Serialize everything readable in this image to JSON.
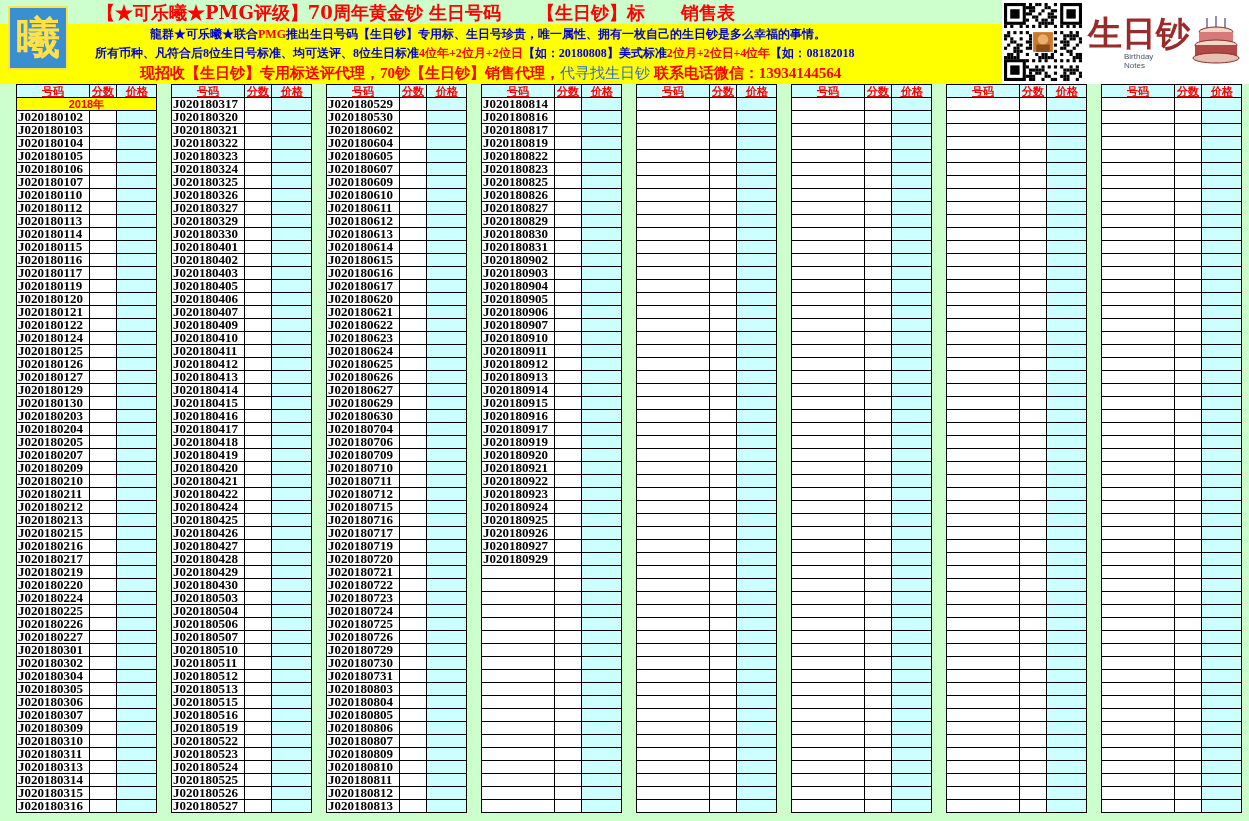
{
  "banner": {
    "logo_glyph": "曦",
    "title": "【★可乐曦★PMG评级】70周年黄金钞 生日号码　　【生日钞】标　　销售表",
    "lines": [
      [
        {
          "text": "龍群★可乐曦★联合",
          "color": "#0000cc"
        },
        {
          "text": "PMG",
          "color": "#ff0000"
        },
        {
          "text": "推出生日号码【生日钞】专用标、生日号珍贵，唯一属性、拥有一枚自己的生日钞是多么幸福的事情。",
          "color": "#0000cc"
        }
      ],
      [
        {
          "text": "所有币种、凡符合后8位生日号标准、均可送评、8位生日标准",
          "color": "#0000cc"
        },
        {
          "text": "4位年+2位月+2位日",
          "color": "#ff0000"
        },
        {
          "text": "【如：20180808】美式标准",
          "color": "#0000cc"
        },
        {
          "text": "2位月+2位日+4位年",
          "color": "#ff0000"
        },
        {
          "text": "【如：08182018",
          "color": "#0000cc"
        }
      ],
      [
        {
          "text": "现招收【生日钞】专用标送评代理，70钞【生日钞】销售代理，",
          "color": "#ff0000"
        },
        {
          "text": "代寻找生日钞",
          "color": "#3366cc"
        },
        {
          "text": " 联系电话微信：13934144564",
          "color": "#ff0000"
        }
      ]
    ],
    "brand": {
      "text": "生日钞",
      "subtitle_1": "Birthday",
      "subtitle_2": "Notes"
    }
  },
  "table": {
    "column_groups": [
      {
        "headers": [
          "号码",
          "分数",
          "价格"
        ],
        "rows": [
          {
            "kind": "year",
            "text": "2018年"
          },
          {
            "kind": "code",
            "code": "J020180102"
          },
          {
            "kind": "code",
            "code": "J020180103"
          },
          {
            "kind": "code",
            "code": "J020180104"
          },
          {
            "kind": "code",
            "code": "J020180105"
          },
          {
            "kind": "code",
            "code": "J020180106"
          },
          {
            "kind": "code",
            "code": "J020180107"
          },
          {
            "kind": "code",
            "code": "J020180110"
          },
          {
            "kind": "code",
            "code": "J020180112"
          },
          {
            "kind": "code",
            "code": "J020180113"
          },
          {
            "kind": "code",
            "code": "J020180114"
          },
          {
            "kind": "code",
            "code": "J020180115"
          },
          {
            "kind": "code",
            "code": "J020180116"
          },
          {
            "kind": "code",
            "code": "J020180117"
          },
          {
            "kind": "code",
            "code": "J020180119"
          },
          {
            "kind": "code",
            "code": "J020180120"
          },
          {
            "kind": "code",
            "code": "J020180121"
          },
          {
            "kind": "code",
            "code": "J020180122"
          },
          {
            "kind": "code",
            "code": "J020180124"
          },
          {
            "kind": "code",
            "code": "J020180125"
          },
          {
            "kind": "code",
            "code": "J020180126"
          },
          {
            "kind": "code",
            "code": "J020180127"
          },
          {
            "kind": "code",
            "code": "J020180129"
          },
          {
            "kind": "code",
            "code": "J020180130"
          },
          {
            "kind": "code",
            "code": "J020180203"
          },
          {
            "kind": "code",
            "code": "J020180204"
          },
          {
            "kind": "code",
            "code": "J020180205"
          },
          {
            "kind": "code",
            "code": "J020180207"
          },
          {
            "kind": "code",
            "code": "J020180209"
          },
          {
            "kind": "code",
            "code": "J020180210"
          },
          {
            "kind": "code",
            "code": "J020180211"
          },
          {
            "kind": "code",
            "code": "J020180212"
          },
          {
            "kind": "code",
            "code": "J020180213"
          },
          {
            "kind": "code",
            "code": "J020180215"
          },
          {
            "kind": "code",
            "code": "J020180216"
          },
          {
            "kind": "code",
            "code": "J020180217"
          },
          {
            "kind": "code",
            "code": "J020180219"
          },
          {
            "kind": "code",
            "code": "J020180220"
          },
          {
            "kind": "code",
            "code": "J020180224"
          },
          {
            "kind": "code",
            "code": "J020180225"
          },
          {
            "kind": "code",
            "code": "J020180226"
          },
          {
            "kind": "code",
            "code": "J020180227"
          },
          {
            "kind": "code",
            "code": "J020180301"
          },
          {
            "kind": "code",
            "code": "J020180302"
          },
          {
            "kind": "code",
            "code": "J020180304"
          },
          {
            "kind": "code",
            "code": "J020180305"
          },
          {
            "kind": "code",
            "code": "J020180306"
          },
          {
            "kind": "code",
            "code": "J020180307"
          },
          {
            "kind": "code",
            "code": "J020180309"
          },
          {
            "kind": "code",
            "code": "J020180310"
          },
          {
            "kind": "code",
            "code": "J020180311"
          },
          {
            "kind": "code",
            "code": "J020180313"
          },
          {
            "kind": "code",
            "code": "J020180314"
          },
          {
            "kind": "code",
            "code": "J020180315"
          },
          {
            "kind": "code",
            "code": "J020180316"
          }
        ]
      },
      {
        "headers": [
          "号码",
          "分数",
          "价格"
        ],
        "rows": [
          {
            "kind": "code",
            "code": "J020180317"
          },
          {
            "kind": "code",
            "code": "J020180320"
          },
          {
            "kind": "code",
            "code": "J020180321"
          },
          {
            "kind": "code",
            "code": "J020180322"
          },
          {
            "kind": "code",
            "code": "J020180323"
          },
          {
            "kind": "code",
            "code": "J020180324"
          },
          {
            "kind": "code",
            "code": "J020180325"
          },
          {
            "kind": "code",
            "code": "J020180326"
          },
          {
            "kind": "code",
            "code": "J020180327"
          },
          {
            "kind": "code",
            "code": "J020180329"
          },
          {
            "kind": "code",
            "code": "J020180330"
          },
          {
            "kind": "code",
            "code": "J020180401"
          },
          {
            "kind": "code",
            "code": "J020180402"
          },
          {
            "kind": "code",
            "code": "J020180403"
          },
          {
            "kind": "code",
            "code": "J020180405"
          },
          {
            "kind": "code",
            "code": "J020180406"
          },
          {
            "kind": "code",
            "code": "J020180407"
          },
          {
            "kind": "code",
            "code": "J020180409"
          },
          {
            "kind": "code",
            "code": "J020180410"
          },
          {
            "kind": "code",
            "code": "J020180411"
          },
          {
            "kind": "code",
            "code": "J020180412"
          },
          {
            "kind": "code",
            "code": "J020180413"
          },
          {
            "kind": "code",
            "code": "J020180414"
          },
          {
            "kind": "code",
            "code": "J020180415"
          },
          {
            "kind": "code",
            "code": "J020180416"
          },
          {
            "kind": "code",
            "code": "J020180417"
          },
          {
            "kind": "code",
            "code": "J020180418"
          },
          {
            "kind": "code",
            "code": "J020180419"
          },
          {
            "kind": "code",
            "code": "J020180420"
          },
          {
            "kind": "code",
            "code": "J020180421"
          },
          {
            "kind": "code",
            "code": "J020180422"
          },
          {
            "kind": "code",
            "code": "J020180424"
          },
          {
            "kind": "code",
            "code": "J020180425"
          },
          {
            "kind": "code",
            "code": "J020180426"
          },
          {
            "kind": "code",
            "code": "J020180427"
          },
          {
            "kind": "code",
            "code": "J020180428"
          },
          {
            "kind": "code",
            "code": "J020180429"
          },
          {
            "kind": "code",
            "code": "J020180430"
          },
          {
            "kind": "code",
            "code": "J020180503"
          },
          {
            "kind": "code",
            "code": "J020180504"
          },
          {
            "kind": "code",
            "code": "J020180506"
          },
          {
            "kind": "code",
            "code": "J020180507"
          },
          {
            "kind": "code",
            "code": "J020180510"
          },
          {
            "kind": "code",
            "code": "J020180511"
          },
          {
            "kind": "code",
            "code": "J020180512"
          },
          {
            "kind": "code",
            "code": "J020180513"
          },
          {
            "kind": "code",
            "code": "J020180515"
          },
          {
            "kind": "code",
            "code": "J020180516"
          },
          {
            "kind": "code",
            "code": "J020180519"
          },
          {
            "kind": "code",
            "code": "J020180522"
          },
          {
            "kind": "code",
            "code": "J020180523"
          },
          {
            "kind": "code",
            "code": "J020180524"
          },
          {
            "kind": "code",
            "code": "J020180525"
          },
          {
            "kind": "code",
            "code": "J020180526"
          },
          {
            "kind": "code",
            "code": "J020180527"
          }
        ]
      },
      {
        "headers": [
          "号码",
          "分数",
          "价格"
        ],
        "rows": [
          {
            "kind": "code",
            "code": "J020180529"
          },
          {
            "kind": "code",
            "code": "J020180530"
          },
          {
            "kind": "code",
            "code": "J020180602"
          },
          {
            "kind": "code",
            "code": "J020180604"
          },
          {
            "kind": "code",
            "code": "J020180605"
          },
          {
            "kind": "code",
            "code": "J020180607"
          },
          {
            "kind": "code",
            "code": "J020180609"
          },
          {
            "kind": "code",
            "code": "J020180610"
          },
          {
            "kind": "code",
            "code": "J020180611"
          },
          {
            "kind": "code",
            "code": "J020180612"
          },
          {
            "kind": "code",
            "code": "J020180613"
          },
          {
            "kind": "code",
            "code": "J020180614"
          },
          {
            "kind": "code",
            "code": "J020180615"
          },
          {
            "kind": "code",
            "code": "J020180616"
          },
          {
            "kind": "code",
            "code": "J020180617"
          },
          {
            "kind": "code",
            "code": "J020180620"
          },
          {
            "kind": "code",
            "code": "J020180621"
          },
          {
            "kind": "code",
            "code": "J020180622"
          },
          {
            "kind": "code",
            "code": "J020180623"
          },
          {
            "kind": "code",
            "code": "J020180624"
          },
          {
            "kind": "code",
            "code": "J020180625"
          },
          {
            "kind": "code",
            "code": "J020180626"
          },
          {
            "kind": "code",
            "code": "J020180627"
          },
          {
            "kind": "code",
            "code": "J020180629"
          },
          {
            "kind": "code",
            "code": "J020180630"
          },
          {
            "kind": "code",
            "code": "J020180704"
          },
          {
            "kind": "code",
            "code": "J020180706"
          },
          {
            "kind": "code",
            "code": "J020180709"
          },
          {
            "kind": "code",
            "code": "J020180710"
          },
          {
            "kind": "code",
            "code": "J020180711"
          },
          {
            "kind": "code",
            "code": "J020180712"
          },
          {
            "kind": "code",
            "code": "J020180715"
          },
          {
            "kind": "code",
            "code": "J020180716"
          },
          {
            "kind": "code",
            "code": "J020180717"
          },
          {
            "kind": "code",
            "code": "J020180719"
          },
          {
            "kind": "code",
            "code": "J020180720"
          },
          {
            "kind": "code",
            "code": "J020180721"
          },
          {
            "kind": "code",
            "code": "J020180722"
          },
          {
            "kind": "code",
            "code": "J020180723"
          },
          {
            "kind": "code",
            "code": "J020180724"
          },
          {
            "kind": "code",
            "code": "J020180725"
          },
          {
            "kind": "code",
            "code": "J020180726"
          },
          {
            "kind": "code",
            "code": "J020180729"
          },
          {
            "kind": "code",
            "code": "J020180730"
          },
          {
            "kind": "code",
            "code": "J020180731"
          },
          {
            "kind": "code",
            "code": "J020180803"
          },
          {
            "kind": "code",
            "code": "J020180804"
          },
          {
            "kind": "code",
            "code": "J020180805"
          },
          {
            "kind": "code",
            "code": "J020180806"
          },
          {
            "kind": "code",
            "code": "J020180807"
          },
          {
            "kind": "code",
            "code": "J020180809"
          },
          {
            "kind": "code",
            "code": "J020180810"
          },
          {
            "kind": "code",
            "code": "J020180811"
          },
          {
            "kind": "code",
            "code": "J020180812"
          },
          {
            "kind": "code",
            "code": "J020180813"
          }
        ]
      },
      {
        "headers": [
          "号码",
          "分数",
          "价格"
        ],
        "rows": [
          {
            "kind": "code",
            "code": "J020180814"
          },
          {
            "kind": "code",
            "code": "J020180816"
          },
          {
            "kind": "code",
            "code": "J020180817"
          },
          {
            "kind": "code",
            "code": "J020180819"
          },
          {
            "kind": "code",
            "code": "J020180822"
          },
          {
            "kind": "code",
            "code": "J020180823"
          },
          {
            "kind": "code",
            "code": "J020180825"
          },
          {
            "kind": "code",
            "code": "J020180826"
          },
          {
            "kind": "code",
            "code": "J020180827"
          },
          {
            "kind": "code",
            "code": "J020180829"
          },
          {
            "kind": "code",
            "code": "J020180830"
          },
          {
            "kind": "code",
            "code": "J020180831"
          },
          {
            "kind": "code",
            "code": "J020180902"
          },
          {
            "kind": "code",
            "code": "J020180903"
          },
          {
            "kind": "code",
            "code": "J020180904"
          },
          {
            "kind": "code",
            "code": "J020180905"
          },
          {
            "kind": "code",
            "code": "J020180906"
          },
          {
            "kind": "code",
            "code": "J020180907"
          },
          {
            "kind": "code",
            "code": "J020180910"
          },
          {
            "kind": "code",
            "code": "J020180911"
          },
          {
            "kind": "code",
            "code": "J020180912"
          },
          {
            "kind": "code",
            "code": "J020180913"
          },
          {
            "kind": "code",
            "code": "J020180914"
          },
          {
            "kind": "code",
            "code": "J020180915"
          },
          {
            "kind": "code",
            "code": "J020180916"
          },
          {
            "kind": "code",
            "code": "J020180917"
          },
          {
            "kind": "code",
            "code": "J020180919"
          },
          {
            "kind": "code",
            "code": "J020180920"
          },
          {
            "kind": "code",
            "code": "J020180921"
          },
          {
            "kind": "code",
            "code": "J020180922"
          },
          {
            "kind": "code",
            "code": "J020180923"
          },
          {
            "kind": "code",
            "code": "J020180924"
          },
          {
            "kind": "code",
            "code": "J020180925"
          },
          {
            "kind": "code",
            "code": "J020180926"
          },
          {
            "kind": "code",
            "code": "J020180927"
          },
          {
            "kind": "code",
            "code": "J020180929"
          }
        ]
      },
      {
        "headers": [
          "号码",
          "分数",
          "价格"
        ]
      },
      {
        "headers": [
          "号码",
          "分数",
          "价格"
        ]
      },
      {
        "headers": [
          "号码",
          "分数",
          "价格"
        ]
      },
      {
        "headers": [
          "号码",
          "分数",
          "价格"
        ]
      }
    ]
  }
}
